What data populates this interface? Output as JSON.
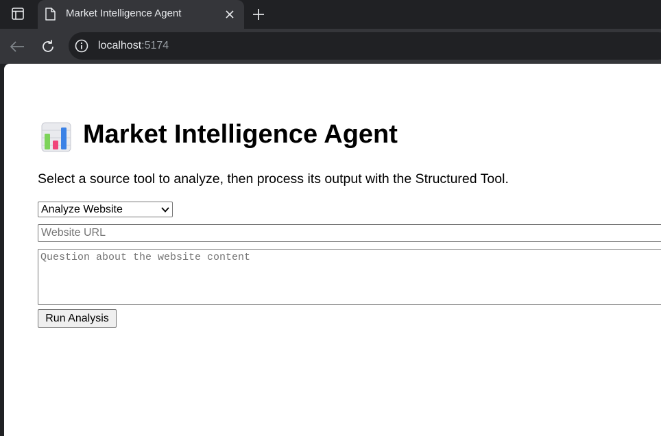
{
  "browser": {
    "tab_title": "Market Intelligence Agent",
    "url_host": "localhost",
    "url_port": ":5174",
    "icons": {
      "tab_search": "tab-search-icon",
      "favicon": "document-icon",
      "close": "close-icon",
      "new_tab": "plus-icon",
      "back": "back-arrow-icon",
      "reload": "reload-icon",
      "site_info": "info-icon"
    }
  },
  "page": {
    "title": "Market Intelligence Agent",
    "title_icon": "bar-chart-icon",
    "description": "Select a source tool to analyze, then process its output with the Structured Tool.",
    "tool_select": {
      "selected": "Analyze Website"
    },
    "url_input": {
      "placeholder": "Website URL",
      "value": ""
    },
    "question_input": {
      "placeholder": "Question about the website content",
      "value": ""
    },
    "run_button": "Run Analysis"
  }
}
